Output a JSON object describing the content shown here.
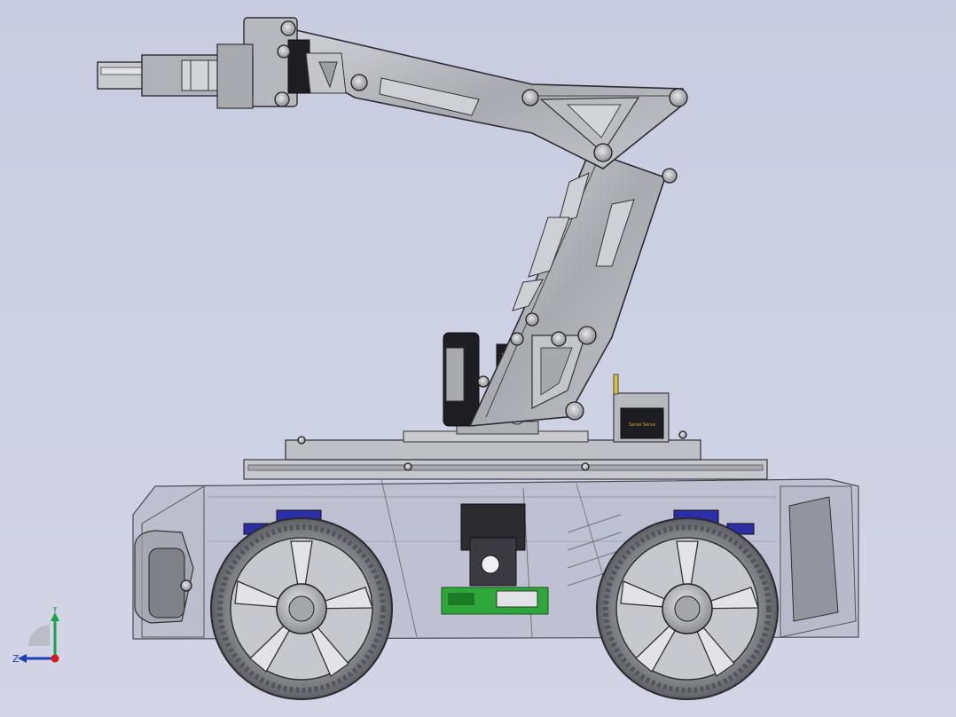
{
  "view": {
    "triad": {
      "y_label": "Y",
      "z_label": "Z",
      "y_color": "#19a34a",
      "z_color": "#1d3fb8",
      "x_color": "#d01c1c"
    }
  },
  "colors": {
    "background": "#cbcde2",
    "metal": "#b4b5ba",
    "metal_dark": "#6e6f75",
    "edge": "#2c2d33",
    "tire": "#8a8b90",
    "servo_black": "#1e1e22",
    "pcb_green": "#2fa83a",
    "copper": "#c98a5c",
    "motor_blue": "#2a2fa8",
    "glass": "#9fa2b8"
  },
  "model": {
    "servo_label": "Serial Servo"
  }
}
